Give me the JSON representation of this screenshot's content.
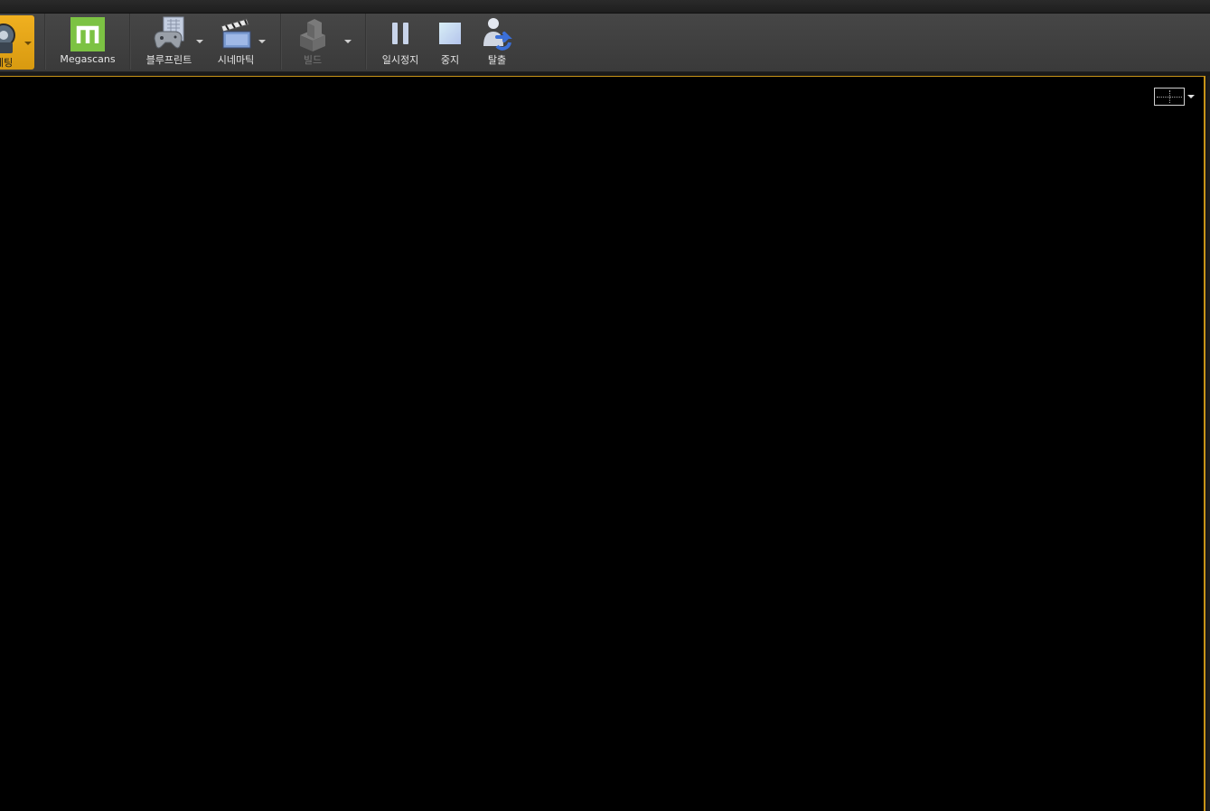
{
  "toolbar": {
    "cut_label": "세팅",
    "megascans_label": "Megascans",
    "blueprint_label": "블루프린트",
    "cinematic_label": "시네마틱",
    "build_label": "빌드",
    "pause_label": "일시정지",
    "stop_label": "중지",
    "eject_label": "탈출"
  },
  "colors": {
    "accent": "#e0a418",
    "megascans_green": "#7cc243",
    "viewport_bg": "#000000"
  },
  "icons": [
    "settings-icon",
    "megascans-icon",
    "blueprint-icon",
    "cinematics-icon",
    "build-icon",
    "pause-icon",
    "stop-icon",
    "eject-icon",
    "viewport-layout-icon",
    "chevron-down-icon"
  ]
}
